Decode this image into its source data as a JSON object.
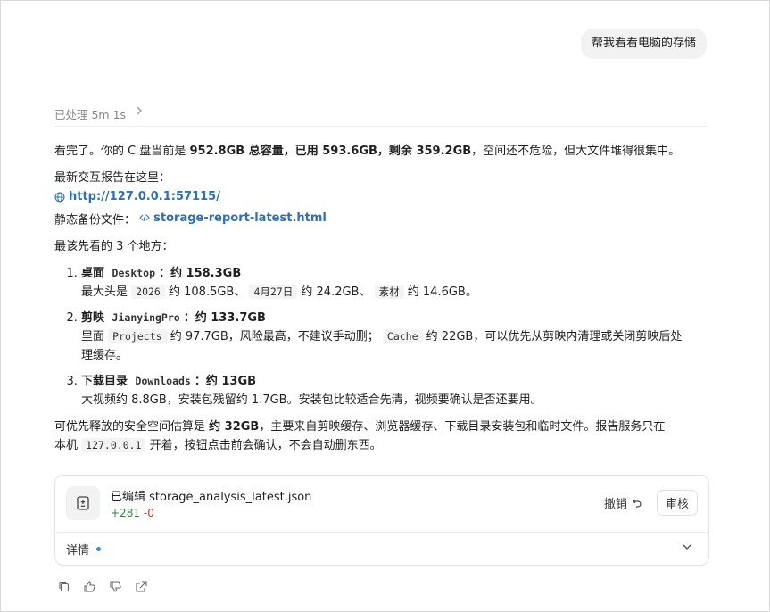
{
  "user_message": "帮我看看电脑的存储",
  "processed": {
    "label": "已处理 5m 1s"
  },
  "summary": {
    "prefix": "看完了。你的 C 盘当前是 ",
    "total": "952.8GB 总容量，已用 593.6GB，剩余 359.2GB",
    "suffix": "，空间还不危险，但大文件堆得很集中。"
  },
  "report": {
    "intro": "最新交互报告在这里：",
    "url": "http://127.0.0.1:57115/",
    "backup_label": "静态备份文件：",
    "backup_file": "storage-report-latest.html"
  },
  "places_intro": "最该先看的 3 个地方：",
  "places": [
    {
      "title_a": "桌面",
      "code": "Desktop",
      "title_b": "：约 158.3GB",
      "line_prefix": "最大头是",
      "items": [
        {
          "code": "2026",
          "text": "约 108.5GB、"
        },
        {
          "code": "4月27日",
          "text": "约 24.2GB、"
        },
        {
          "code": "素材",
          "text": "约 14.6GB。"
        }
      ]
    },
    {
      "title_a": "剪映",
      "code": "JianyingPro",
      "title_b": "：约 133.7GB",
      "line_prefix": "里面",
      "code1": "Projects",
      "text1": "约 97.7GB，风险最高，不建议手动删；",
      "code2": "Cache",
      "text2": "约 22GB，可以优先从剪映内清理或关闭剪映后处",
      "text3": "理缓存。"
    },
    {
      "title_a": "下载目录",
      "code": "Downloads",
      "title_b": "：约 13GB",
      "line": "大视频约 8.8GB，安装包残留约 1.7GB。安装包比较适合先清，视频要确认是否还要用。"
    }
  ],
  "footer": {
    "prefix": "可优先释放的安全空间估算是 ",
    "amount": "约 32GB",
    "middle": "，主要来自剪映缓存、浏览器缓存、下载目录安装包和临时文件。报告服务只在",
    "line2_prefix": "本机",
    "code": "127.0.0.1",
    "line2_suffix": "开着，按钮点击前会确认，不会自动删东西。"
  },
  "edit_card": {
    "title": "已编辑 storage_analysis_latest.json",
    "added": "+281",
    "removed": "-0",
    "undo_label": "撤销",
    "review_label": "审核",
    "details_label": "详情"
  },
  "icons": {
    "undo": "undo-icon",
    "globe": "globe-icon",
    "code": "code-icon",
    "file_diff": "file-diff-icon",
    "chevron": "chevron-down-icon",
    "copy": "copy-icon",
    "thumb_up": "thumbs-up-icon",
    "thumb_down": "thumbs-down-icon",
    "share": "share-icon"
  }
}
